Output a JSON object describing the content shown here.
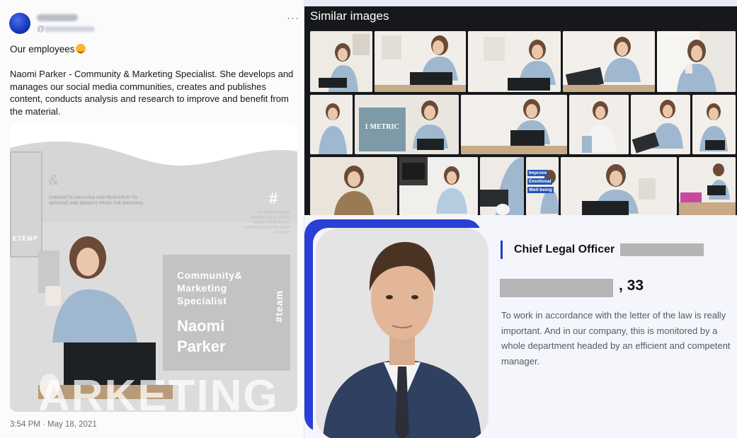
{
  "tweet": {
    "handle_prefix": "@",
    "more_icon": "more-horizontal-icon",
    "intro": "Our employees",
    "intro_emoji": "smiling-face-emoji",
    "body": "Naomi Parker - Community & Marketing Specialist. She develops and manages our social media communities, creates and publishes content, conducts analysis and research to improve and benefit from the material.",
    "timestamp": "3:54 PM · May 18, 2021",
    "image": {
      "frame_text": "ETEMP",
      "ampersand": "&",
      "analysis_text": "CONDUCTS ANALYSIS AND RESEARCH TO IMPROVE AND BENEFIT FROM THE MATERIAL.",
      "hashtag_symbol": "#",
      "small_text": "HE DEVELOPS AND MANAGES OUR SOCIAL MEDIA COMMUNITIES CREATES AND PUBLISHES CONTENT",
      "role": "Community& Marketing Specialist",
      "name": "Naomi Parker",
      "team_tag": "#team",
      "watermark": "ARKETING"
    }
  },
  "similar": {
    "title": "Similar images",
    "card_title": "1 METRIC",
    "tag_improve": "Improve",
    "tag_emotional": "Emotional",
    "tag_wellbeing": "Well-being"
  },
  "profile": {
    "title": "Chief Legal Officer",
    "age": ", 33",
    "description": "To work in accordance with the letter of the law is really important. And in our company, this is monitored by a whole department headed by an efficient and competent manager."
  },
  "colors": {
    "accent_blue": "#2a3fd6",
    "tweet_bg": "#fbfbfc",
    "similar_bg": "#16181c"
  }
}
